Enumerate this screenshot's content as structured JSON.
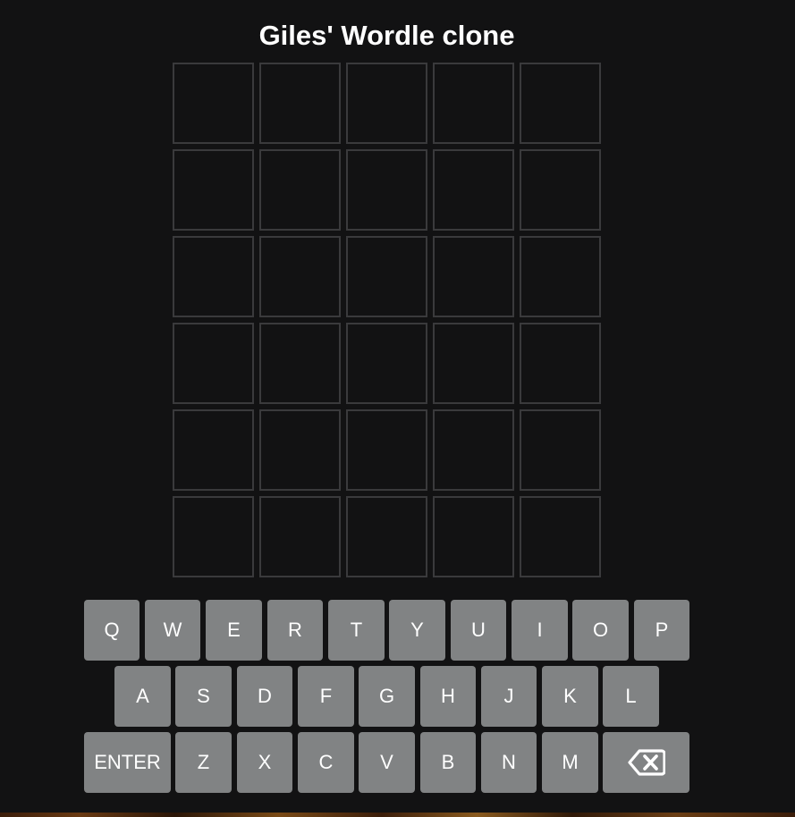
{
  "header": {
    "title": "Giles' Wordle clone"
  },
  "board": {
    "rows": [
      [
        "",
        "",
        "",
        "",
        ""
      ],
      [
        "",
        "",
        "",
        "",
        ""
      ],
      [
        "",
        "",
        "",
        "",
        ""
      ],
      [
        "",
        "",
        "",
        "",
        ""
      ],
      [
        "",
        "",
        "",
        "",
        ""
      ],
      [
        "",
        "",
        "",
        "",
        ""
      ]
    ]
  },
  "keyboard": {
    "row1": [
      "Q",
      "W",
      "E",
      "R",
      "T",
      "Y",
      "U",
      "I",
      "O",
      "P"
    ],
    "row2": [
      "A",
      "S",
      "D",
      "F",
      "G",
      "H",
      "J",
      "K",
      "L"
    ],
    "row3": [
      "ENTER",
      "Z",
      "X",
      "C",
      "V",
      "B",
      "N",
      "M"
    ],
    "backspace_icon": "backspace-icon"
  },
  "colors": {
    "background": "#121213",
    "tile_border": "#3a3a3c",
    "key": "#818384",
    "text": "#ffffff"
  }
}
